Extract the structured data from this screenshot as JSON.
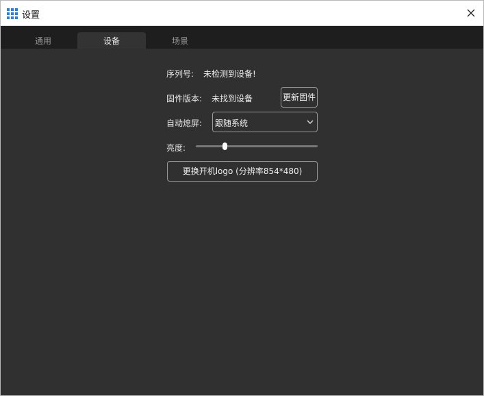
{
  "window": {
    "title": "设置",
    "close_glyph": "✕",
    "icon": "grid-app-icon"
  },
  "tabs": [
    {
      "label": "通用",
      "active": false
    },
    {
      "label": "设备",
      "active": true
    },
    {
      "label": "场景",
      "active": false
    }
  ],
  "device": {
    "serial_label": "序列号:",
    "serial_value": "未检测到设备!",
    "firmware_label": "固件版本:",
    "firmware_value": "未找到设备",
    "update_firmware_button": "更新固件",
    "auto_screen_off_label": "自动熄屏:",
    "auto_screen_off_value": "跟随系统",
    "brightness_label": "亮度:",
    "brightness_fraction": 0.24,
    "change_logo_button": "更换开机logo (分辨率854*480)"
  },
  "colors": {
    "accent_icon": "#2f7fd6",
    "background": "#303030",
    "tabbar": "#1e1e1e"
  }
}
